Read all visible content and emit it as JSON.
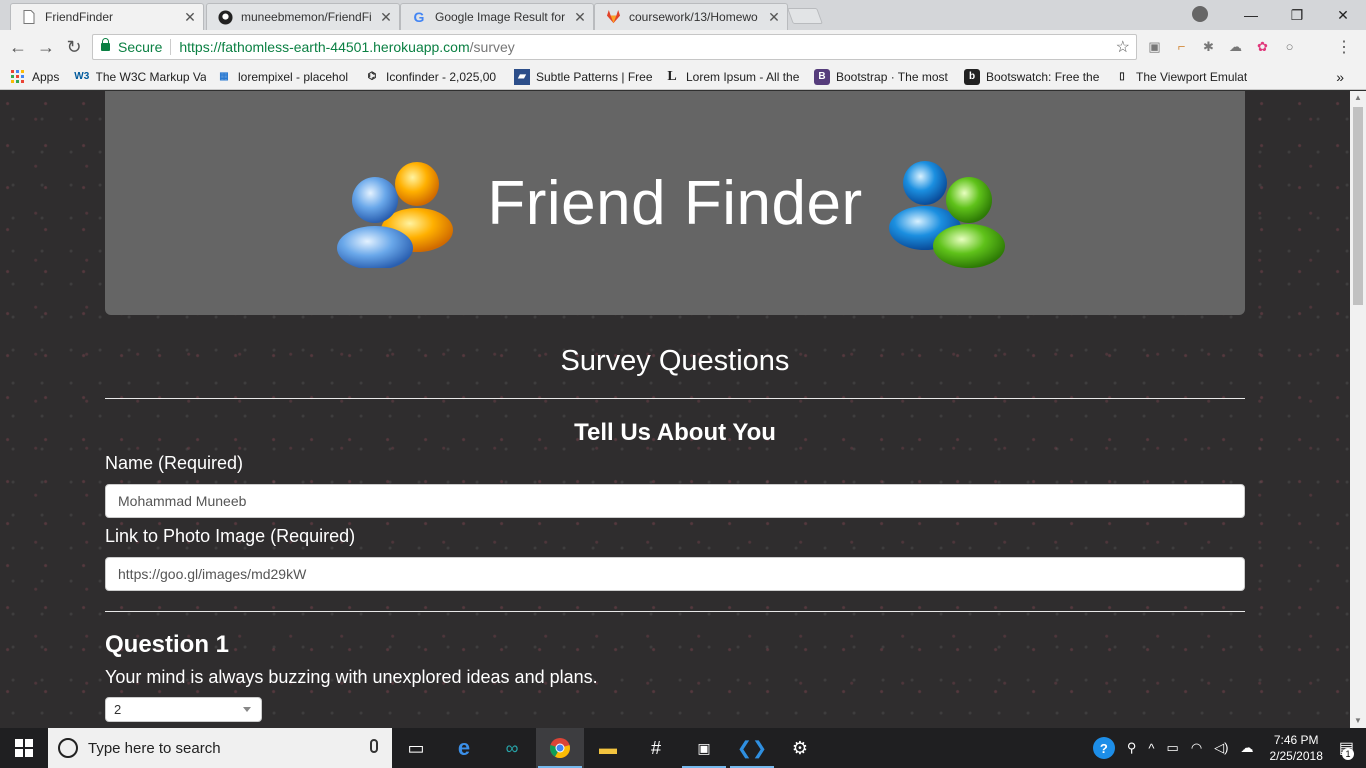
{
  "browser": {
    "tabs": [
      {
        "title": "FriendFinder",
        "active": true,
        "icon": "page-icon"
      },
      {
        "title": "muneebmemon/FriendFi",
        "active": false,
        "icon": "github-icon"
      },
      {
        "title": "Google Image Result for",
        "active": false,
        "icon": "google-icon"
      },
      {
        "title": "coursework/13/Homewo",
        "active": false,
        "icon": "gitlab-icon"
      }
    ],
    "secure_label": "Secure",
    "url_host": "https://fathomless-earth-44501.herokuapp.com",
    "url_path": "/survey",
    "bookmarks": [
      {
        "label": "Apps",
        "icon": "apps-grid-icon"
      },
      {
        "label": "The W3C Markup Val",
        "icon": "w3c-icon"
      },
      {
        "label": "lorempixel - placehol",
        "icon": "lorempixel-icon"
      },
      {
        "label": "Iconfinder - 2,025,00",
        "icon": "iconfinder-icon"
      },
      {
        "label": "Subtle Patterns | Free",
        "icon": "subtlepatterns-icon"
      },
      {
        "label": "Lorem Ipsum - All the",
        "icon": "lorem-ipsum-icon"
      },
      {
        "label": "Bootstrap · The most",
        "icon": "bootstrap-icon"
      },
      {
        "label": "Bootswatch: Free the",
        "icon": "bootswatch-icon"
      },
      {
        "label": "The Viewport Emulat",
        "icon": "viewport-icon"
      }
    ],
    "bookmarks_overflow": "»"
  },
  "page": {
    "site_title": "Friend Finder",
    "section_title": "Survey Questions",
    "sub_title": "Tell Us About You",
    "name_label": "Name (Required)",
    "name_value": "Mohammad Muneeb",
    "photo_label": "Link to Photo Image (Required)",
    "photo_value": "https://goo.gl/images/md29kW",
    "question_title": "Question 1",
    "question_text": "Your mind is always buzzing with unexplored ideas and plans.",
    "question_answer": "2"
  },
  "taskbar": {
    "search_placeholder": "Type here to search",
    "time": "7:46 PM",
    "date": "2/25/2018",
    "notification_count": "1"
  },
  "colors": {
    "jumbotron": "#656565",
    "page_background": "#2f2d2e",
    "secure_green": "#0b8043",
    "taskbar": "#1f1f21"
  }
}
